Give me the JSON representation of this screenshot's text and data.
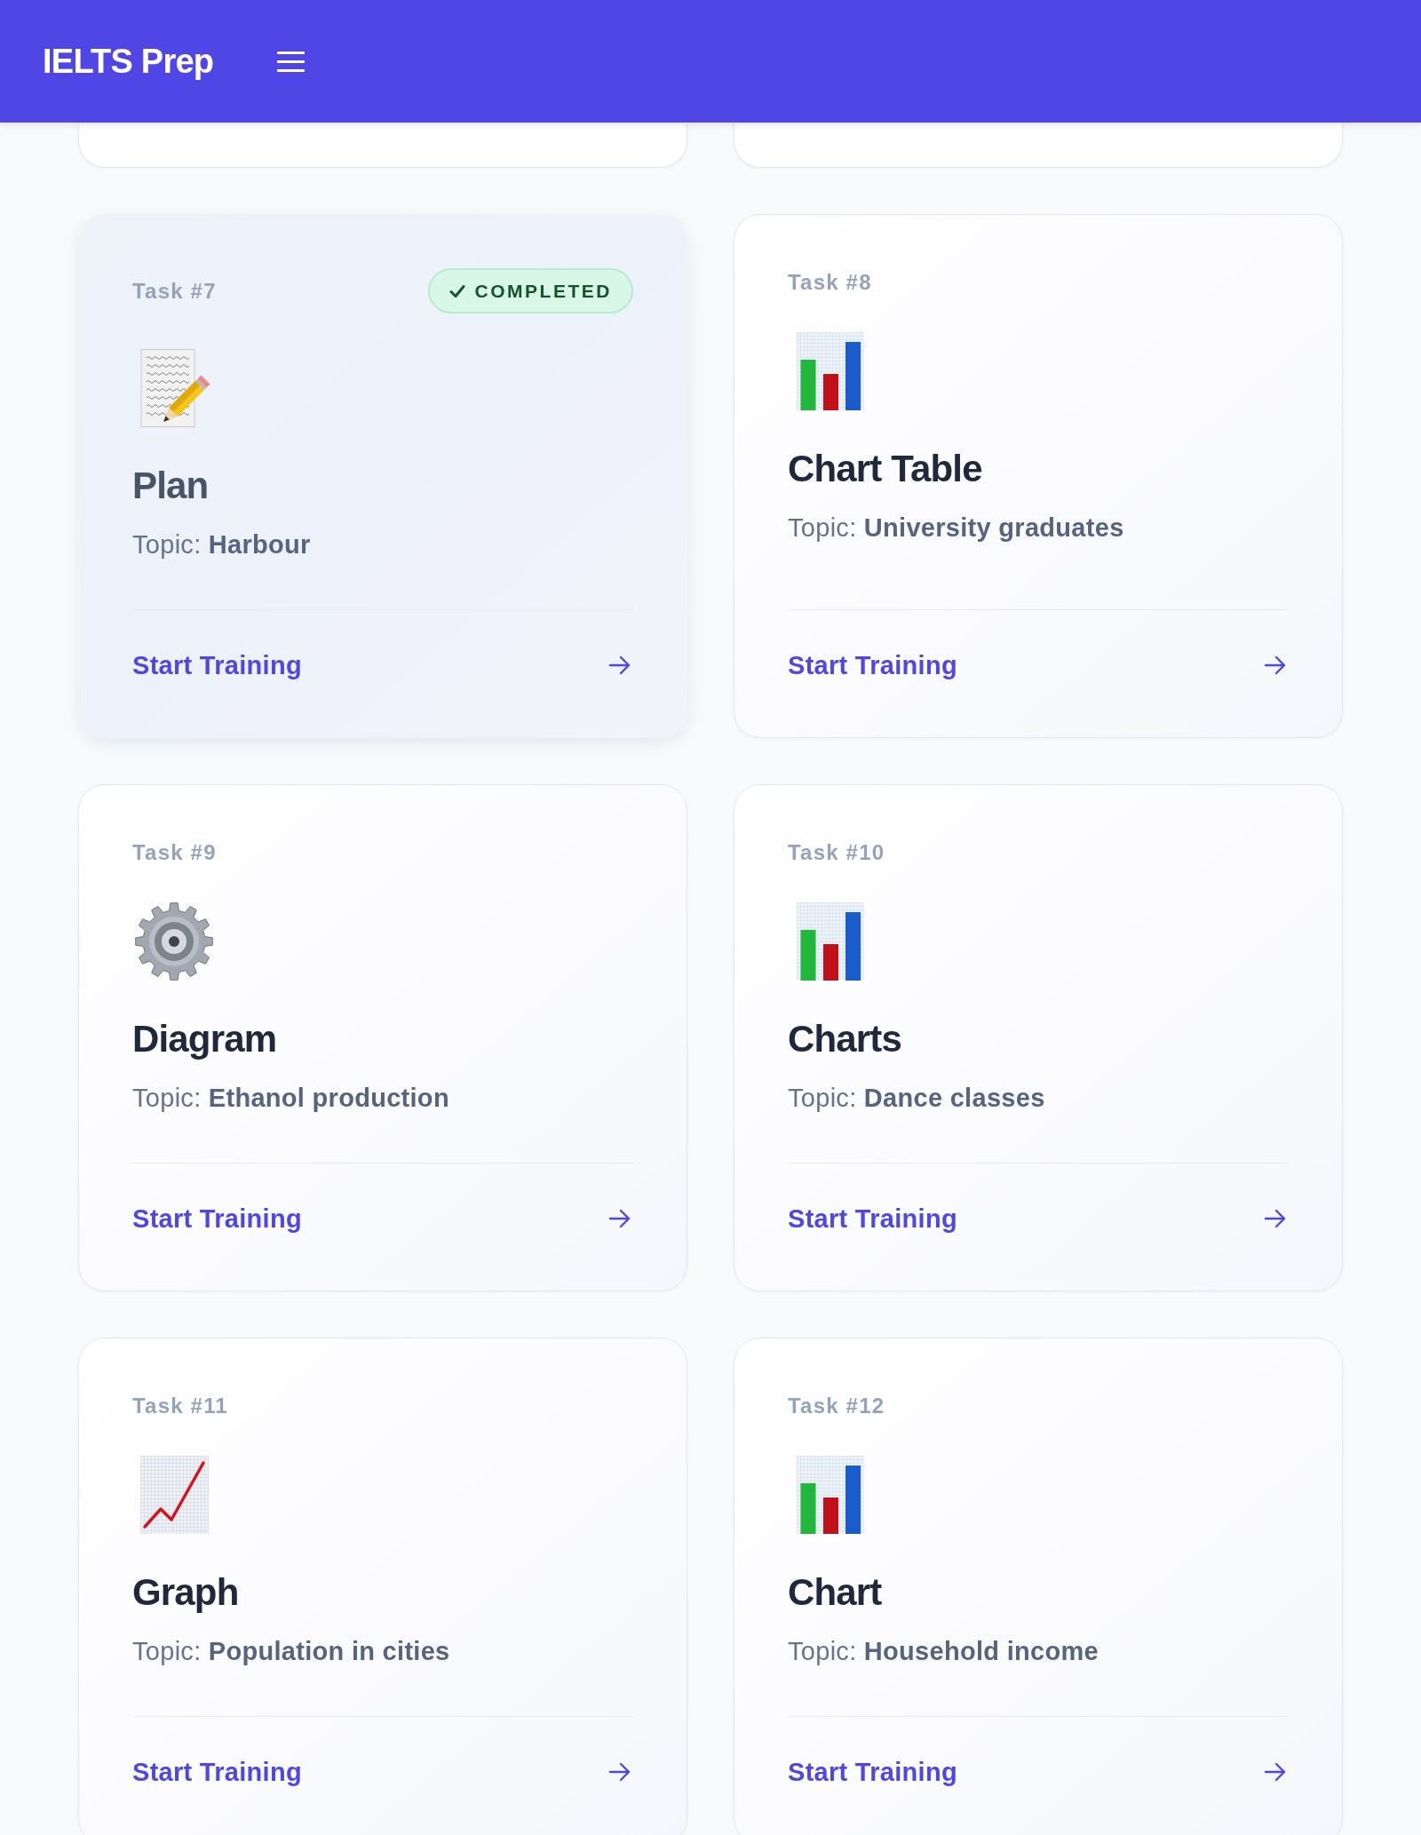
{
  "header": {
    "title": "IELTS Prep"
  },
  "cards": [
    {
      "task": "Task #7",
      "completed": true,
      "badge": "COMPLETED",
      "kind": "memo",
      "title": "Plan",
      "topic": "Topic: **Harbour**",
      "action": "Start Training"
    },
    {
      "task": "Task #8",
      "completed": false,
      "kind": "bars",
      "title": "Chart Table",
      "topic": "Topic: **University graduates**",
      "action": "Start Training"
    },
    {
      "task": "Task #9",
      "completed": false,
      "kind": "gear",
      "title": "Diagram",
      "topic": "Topic: **Ethanol production**",
      "action": "Start Training"
    },
    {
      "task": "Task #10",
      "completed": false,
      "kind": "bars",
      "title": "Charts",
      "topic": "Topic: **Dance classes**",
      "action": "Start Training"
    },
    {
      "task": "Task #11",
      "completed": false,
      "kind": "line",
      "title": "Graph",
      "topic": "Topic: **Population in cities**",
      "action": "Start Training"
    },
    {
      "task": "Task #12",
      "completed": false,
      "kind": "bars",
      "title": "Chart",
      "topic": "Topic: **Household income**",
      "action": "Start Training"
    }
  ]
}
